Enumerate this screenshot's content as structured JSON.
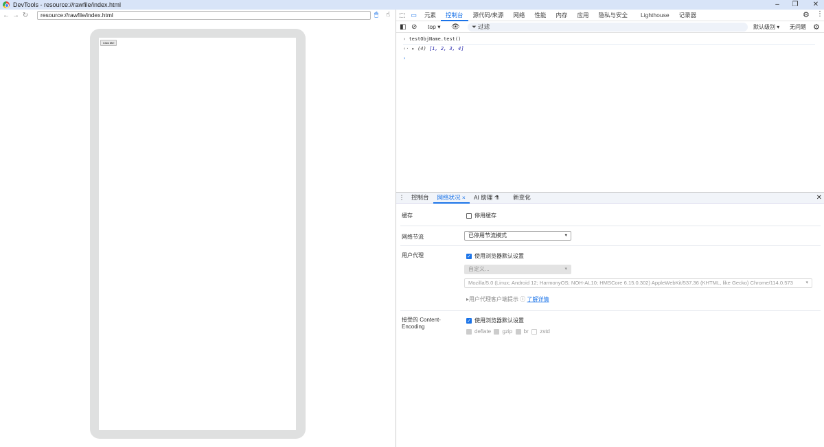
{
  "window": {
    "title": "DevTools - resource://rawfile/index.html"
  },
  "browser": {
    "url": "resource://rawfile/index.html"
  },
  "page": {
    "button_label": "Click Me!"
  },
  "devtools": {
    "tabs": [
      "元素",
      "控制台",
      "源代码/来源",
      "网络",
      "性能",
      "内存",
      "应用",
      "隐私与安全",
      "Lighthouse",
      "记录器"
    ],
    "active_tab": "控制台",
    "console_toolbar": {
      "context": "top",
      "filter_placeholder": "过滤",
      "level": "默认级别",
      "issues": "无问题"
    },
    "console": {
      "input": "testObjName.test()",
      "result_count": "(4)",
      "result": "[1, 2, 3, 4]"
    },
    "drawer": {
      "tabs": [
        "控制台",
        "网络状况",
        "AI 助理",
        "新变化"
      ],
      "active_tab": "网络状况",
      "cache": {
        "label": "缓存",
        "checkbox": "停用缓存"
      },
      "throttling": {
        "label": "网络节流",
        "value": "已停用节流模式"
      },
      "user_agent": {
        "label": "用户代理",
        "checkbox": "使用浏览器默认设置",
        "select": "自定义...",
        "ua_string": "Mozilla/5.0 (Linux; Android 12; HarmonyOS; NOH-AL10; HMSCore 6.15.0.302) AppleWebKit/537.36 (KHTML, like Gecko) Chrome/114.0.573",
        "hints": "用户代理客户端提示",
        "learn_more": "了解详情"
      },
      "encoding": {
        "label": "接受的 Content-Encoding",
        "checkbox": "使用浏览器默认设置",
        "options": [
          "deflate",
          "gzip",
          "br",
          "zstd"
        ]
      }
    }
  }
}
